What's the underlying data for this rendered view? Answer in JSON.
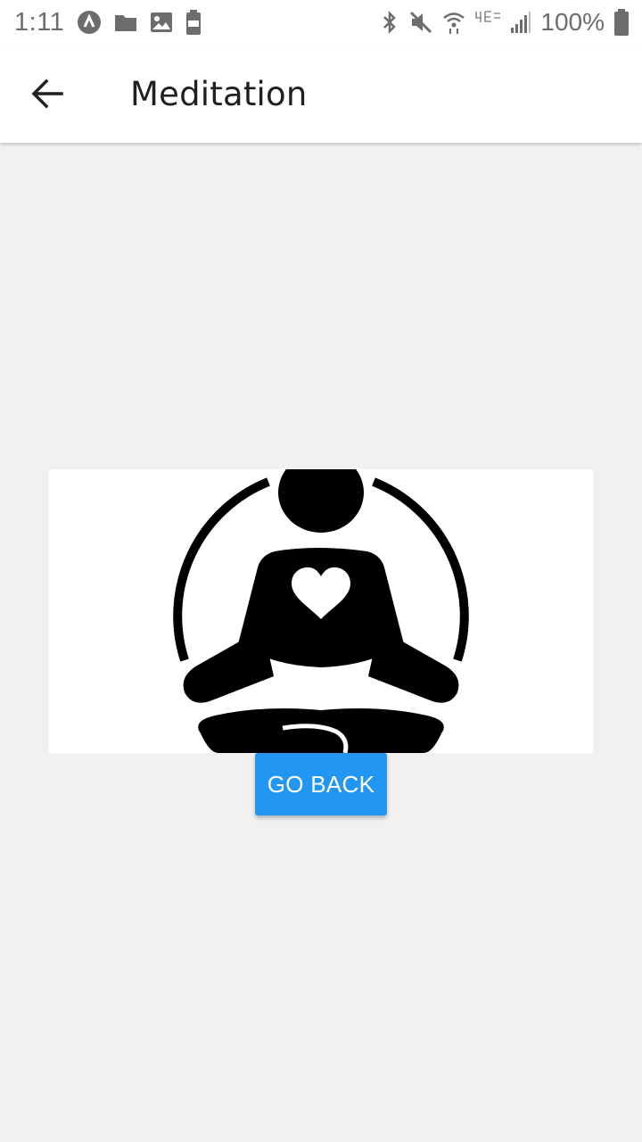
{
  "status_bar": {
    "time": "1:11",
    "battery_percent": "100%",
    "left_icons": [
      "app-notification-icon",
      "folder-icon",
      "image-icon",
      "battery-saver-icon"
    ],
    "right_icons": [
      "bluetooth-icon",
      "mute-icon",
      "wifi-icon",
      "lte-icon",
      "signal-icon",
      "battery-icon"
    ]
  },
  "app_bar": {
    "title": "Meditation",
    "back_icon": "arrow-back-icon"
  },
  "main": {
    "image_icon": "meditation-figure-icon",
    "button_label": "GO BACK"
  },
  "colors": {
    "accent": "#2196f3",
    "background": "#f1f1f1",
    "surface": "#ffffff"
  }
}
